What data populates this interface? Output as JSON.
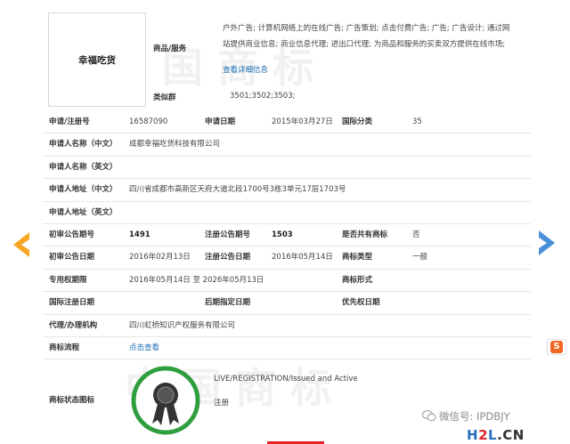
{
  "brand": {
    "name": "幸福吃货"
  },
  "goods_services": {
    "label": "商品/服务",
    "lines": [
      "户外广告; 计算机网络上的在线广告; 广告策划; 点击付费广告; 广告; 广告设计; 通过网",
      "站提供商业信息; 商业信息代理; 进出口代理; 为商品和服务的买卖双方提供在线市场;"
    ],
    "more_link": "查看详细信息"
  },
  "similar_group": {
    "label": "类似群",
    "value": "3501;3502;3503;"
  },
  "fields": {
    "reg_no_label": "申请/注册号",
    "reg_no": "16587090",
    "app_date_label": "申请日期",
    "app_date": "2015年03月27日",
    "intl_class_label": "国际分类",
    "intl_class": "35",
    "applicant_cn_label": "申请人名称（中文）",
    "applicant_cn": "成都幸福吃货科技有限公司",
    "applicant_en_label": "申请人名称（英文）",
    "address_cn_label": "申请人地址（中文）",
    "address_cn": "四川省成都市高新区天府大道北段1700号3栋3单元17层1703号",
    "address_en_label": "申请人地址（英文）",
    "prelim_no_label": "初审公告期号",
    "prelim_no": "1491",
    "reg_pub_no_label": "注册公告期号",
    "reg_pub_no": "1503",
    "shared_label": "是否共有商标",
    "shared": "否",
    "prelim_date_label": "初审公告日期",
    "prelim_date": "2016年02月13日",
    "reg_pub_date_label": "注册公告日期",
    "reg_pub_date": "2016年05月14日",
    "tm_type_label": "商标类型",
    "tm_type": "一般",
    "exclusive_label": "专用权期限",
    "exclusive": "2016年05月14日 至 2026年05月13日",
    "tm_form_label": "商标形式",
    "intl_reg_date_label": "国际注册日期",
    "later_date_label": "后期指定日期",
    "priority_date_label": "优先权日期",
    "agent_label": "代理/办理机构",
    "agent": "四川虹桥知识产权服务有限公司",
    "process_label": "商标流程",
    "process_link": "点击查看",
    "status_icon_label": "商标状态图标",
    "status_en": "LIVE/REGISTRATION/Issued and Active",
    "status_cn": "注册"
  },
  "watermark": "中 国 商 标",
  "footer": {
    "wechat": "微信号: IPDBJY",
    "site_h": "H",
    "site_2": "2",
    "site_l": "L",
    "site_dot": ".",
    "site_cn": "CN"
  },
  "colors": {
    "link": "#1c6fb3",
    "arrow_left": "#f5a623",
    "arrow_right": "#4a90d9",
    "badge_ring": "#2e9e3e"
  }
}
